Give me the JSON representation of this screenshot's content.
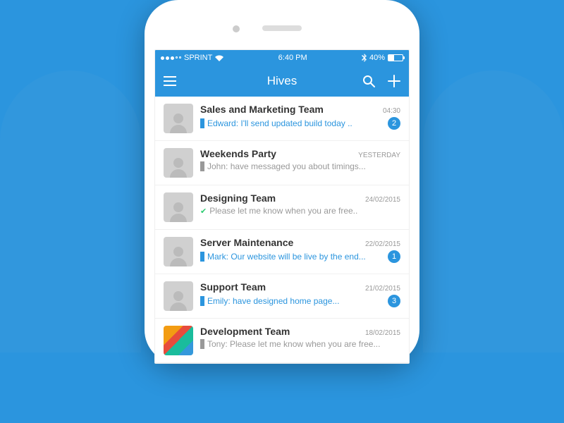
{
  "status_bar": {
    "carrier": "SPRINT",
    "time": "6:40 PM",
    "battery_pct": "40%"
  },
  "nav": {
    "title": "Hives"
  },
  "chats": [
    {
      "title": "Sales and Marketing Team",
      "time": "04:30",
      "preview": "Edward: I'll send updated build today ..",
      "state": "unread",
      "icon": "play",
      "badge": "2",
      "avatar": "person"
    },
    {
      "title": "Weekends Party",
      "time": "YESTERDAY",
      "preview": "John: have messaged you about timings...",
      "state": "read",
      "icon": "play",
      "badge": "",
      "avatar": "person"
    },
    {
      "title": "Designing Team",
      "time": "24/02/2015",
      "preview": "Please let me know when you are free..",
      "state": "sent",
      "icon": "check",
      "badge": "",
      "avatar": "person"
    },
    {
      "title": "Server Maintenance",
      "time": "22/02/2015",
      "preview": "Mark: Our website will be live by the end...",
      "state": "unread",
      "icon": "play",
      "badge": "1",
      "avatar": "person"
    },
    {
      "title": "Support Team",
      "time": "21/02/2015",
      "preview": "Emily: have designed home page...",
      "state": "unread",
      "icon": "play",
      "badge": "3",
      "avatar": "person"
    },
    {
      "title": "Development Team",
      "time": "18/02/2015",
      "preview": "Tony: Please let me know when you are free...",
      "state": "read",
      "icon": "play",
      "badge": "",
      "avatar": "colorful"
    }
  ]
}
